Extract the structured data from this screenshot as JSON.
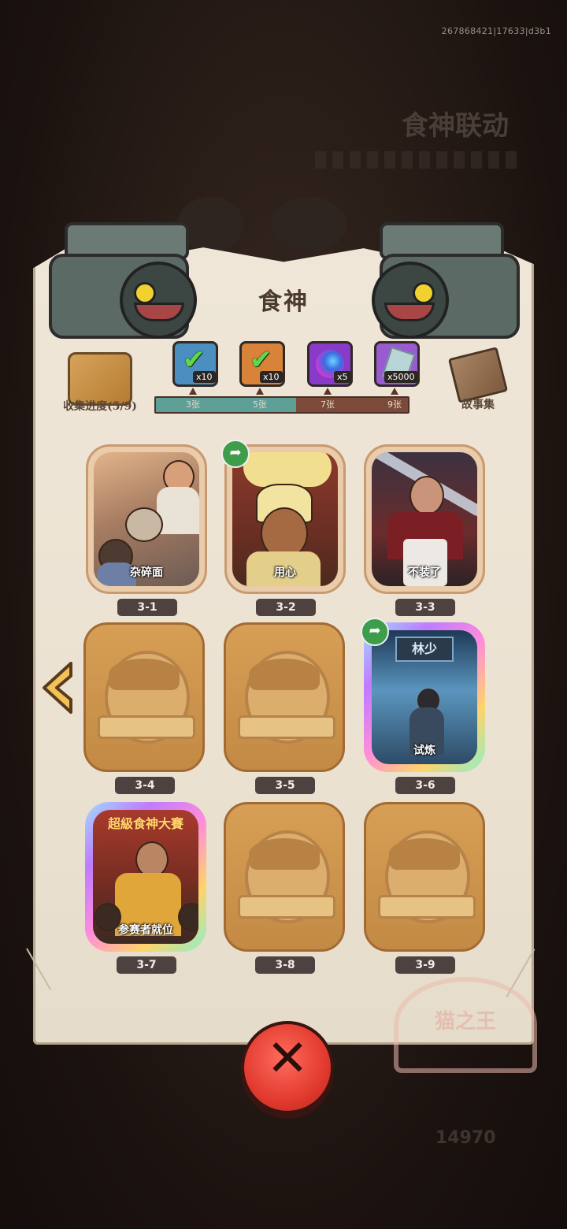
{
  "build_id": "267868421|17633|d3b1",
  "background": {
    "event_title": "食神联动",
    "currency_value": "14970"
  },
  "panel": {
    "title": "食神",
    "collect_label": "收集进度(5/9)",
    "story_label": "故事集",
    "stamp_text": "猫之王"
  },
  "rewards": [
    {
      "name": "chest-blue",
      "count": "x10",
      "claimed": true,
      "color": "#4a8fc0"
    },
    {
      "name": "chest-orange",
      "count": "x10",
      "claimed": true,
      "color": "#d8823a"
    },
    {
      "name": "gem-orb",
      "count": "x5",
      "claimed": false,
      "color": "#8a3ac8"
    },
    {
      "name": "crystal",
      "count": "x5000",
      "claimed": false,
      "color": "#9a5ad0"
    }
  ],
  "progress": {
    "collected": 5,
    "total": 9,
    "ticks": [
      "3张",
      "5张",
      "7张",
      "9张"
    ]
  },
  "cards": [
    {
      "id": "3-1",
      "caption": "杂碎面",
      "state": "unlocked",
      "share": false
    },
    {
      "id": "3-2",
      "caption": "用心",
      "state": "unlocked",
      "share": true
    },
    {
      "id": "3-3",
      "caption": "不装了",
      "state": "unlocked",
      "share": false
    },
    {
      "id": "3-4",
      "caption": "",
      "state": "locked",
      "share": false
    },
    {
      "id": "3-5",
      "caption": "",
      "state": "locked",
      "share": false
    },
    {
      "id": "3-6",
      "caption": "试炼",
      "state": "rainbow",
      "share": true,
      "sign": "林少"
    },
    {
      "id": "3-7",
      "caption": "参赛者就位",
      "state": "rainbow",
      "share": false,
      "banner": "超級食神大賽"
    },
    {
      "id": "3-8",
      "caption": "",
      "state": "locked",
      "share": false
    },
    {
      "id": "3-9",
      "caption": "",
      "state": "locked",
      "share": false
    }
  ],
  "icons": {
    "prev": "chevron-left-icon",
    "close": "close-icon",
    "share": "share-icon"
  },
  "colors": {
    "close_button": "#e23a2e",
    "progress_fill": "#5e9f96",
    "progress_track": "#7b4a38",
    "share_badge": "#3e9d4b"
  }
}
